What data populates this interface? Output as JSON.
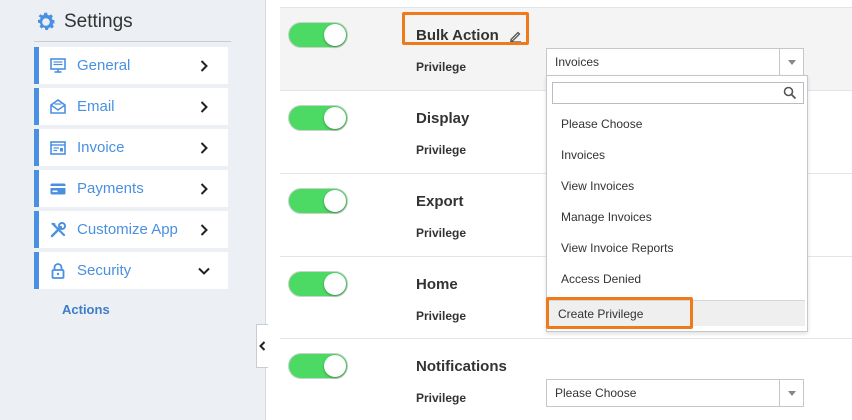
{
  "sidebar": {
    "title": "Settings",
    "accent": "#4a90e2",
    "items": [
      {
        "label": "General",
        "icon": "monitor-icon"
      },
      {
        "label": "Email",
        "icon": "envelope-open-icon"
      },
      {
        "label": "Invoice",
        "icon": "invoice-icon"
      },
      {
        "label": "Payments",
        "icon": "credit-card-icon"
      },
      {
        "label": "Customize App",
        "icon": "tools-icon"
      },
      {
        "label": "Security",
        "icon": "lock-icon",
        "expanded": true
      }
    ],
    "sub_item": "Actions"
  },
  "modules": [
    {
      "title": "Bulk Action",
      "privilege_label": "Privilege",
      "privilege_value": "Invoices",
      "enabled": true
    },
    {
      "title": "Display",
      "privilege_label": "Privilege",
      "privilege_value": "",
      "enabled": true
    },
    {
      "title": "Export",
      "privilege_label": "Privilege",
      "privilege_value": "",
      "enabled": true
    },
    {
      "title": "Home",
      "privilege_label": "Privilege",
      "privilege_value": "",
      "enabled": true
    },
    {
      "title": "Notifications",
      "privilege_label": "Privilege",
      "privilege_value": "Please Choose",
      "enabled": true
    }
  ],
  "dropdown": {
    "search_value": "",
    "options": [
      "Please Choose",
      "Invoices",
      "View Invoices",
      "Manage Invoices",
      "View Invoice Reports",
      "Access Denied"
    ],
    "create_label": "Create Privilege"
  },
  "colors": {
    "toggle_on": "#4cd964",
    "highlight_box": "#f07a1a"
  }
}
